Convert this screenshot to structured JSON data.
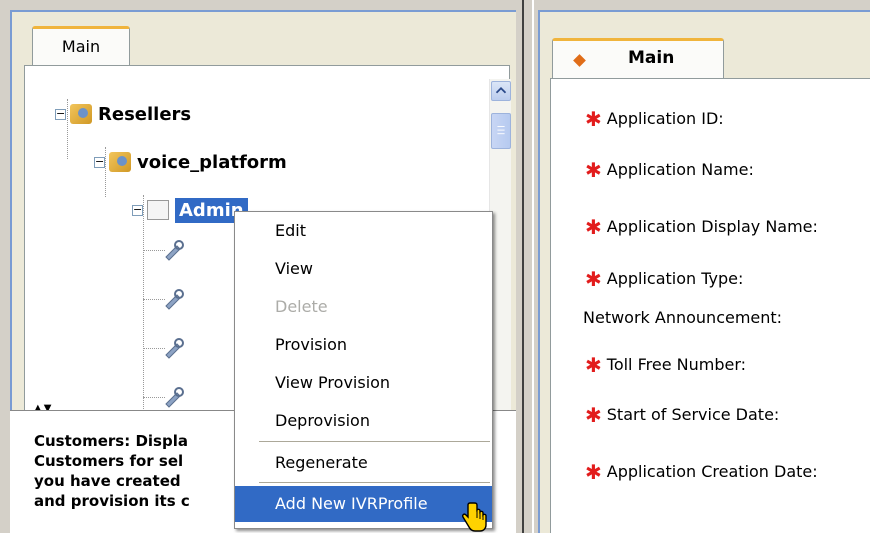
{
  "left_panel": {
    "tab_label": "Main",
    "tree": {
      "root": {
        "label": "Resellers"
      },
      "child": {
        "label": "voice_platform"
      },
      "selected": {
        "label": "Admin"
      },
      "expander_symbol": "−"
    },
    "help_lines": [
      "Customers: Displa",
      "Customers for sel",
      "you have created",
      "and provision its c"
    ]
  },
  "right_panel": {
    "tab_label": "Main",
    "required_marker": "✱",
    "fields": [
      {
        "label": "Application ID:",
        "required": true
      },
      {
        "label": "Application Name:",
        "required": true
      },
      {
        "label": "Application Display Name:",
        "required": true
      },
      {
        "label": "Application Type:",
        "required": true
      },
      {
        "label": "Network Announcement:",
        "required": false
      },
      {
        "label": "Toll Free Number:",
        "required": true
      },
      {
        "label": "Start of Service Date:",
        "required": true
      },
      {
        "label": "Application Creation Date:",
        "required": true
      }
    ]
  },
  "context_menu": {
    "items": [
      {
        "label": "Edit",
        "state": "normal"
      },
      {
        "label": "View",
        "state": "normal"
      },
      {
        "label": "Delete",
        "state": "disabled"
      },
      {
        "label": "Provision",
        "state": "normal"
      },
      {
        "label": "View Provision",
        "state": "normal"
      },
      {
        "label": "Deprovision",
        "state": "normal"
      },
      {
        "label": "Regenerate",
        "state": "normal"
      },
      {
        "label": "Add New IVRProfile",
        "state": "highlighted"
      }
    ]
  },
  "colors": {
    "selection": "#316ac5",
    "required_star": "#e21c1c",
    "tab_accent": "#f0b43c"
  }
}
